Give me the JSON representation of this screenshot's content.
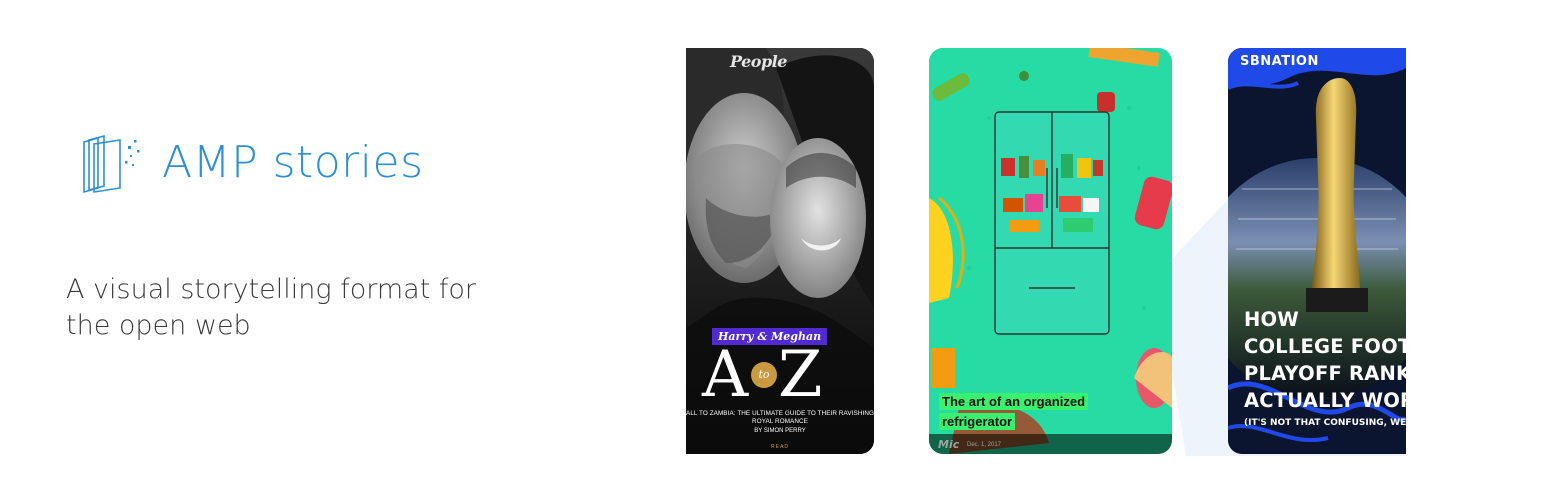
{
  "brand": {
    "logo_icon": "amp-stories-logo-icon",
    "name": "AMP stories",
    "color": "#2d8fd7"
  },
  "tagline": {
    "line1": "A visual storytelling format for",
    "line2": "the open web"
  },
  "stories": [
    {
      "publisher": "People",
      "tag": "Harry & Meghan",
      "title_left": "A",
      "title_mid": "to",
      "title_right": "Z",
      "subtitle_line1": "ALL TO ZAMBIA: THE ULTIMATE GUIDE TO THEIR RAVISHING",
      "subtitle_line2": "ROYAL ROMANCE",
      "author": "BY SIMON PERRY",
      "cta": "READ",
      "accent": "#4f2bd1"
    },
    {
      "caption_line1": "The art of an organized",
      "caption_line2": "refrigerator",
      "publisher": "Mic",
      "date": "Dec. 1, 2017",
      "background": "#26dca4",
      "highlight": "#39f06f"
    },
    {
      "publisher": "SBNATION",
      "title_line1": "HOW",
      "title_line2": "COLLEGE FOOTB",
      "title_line3": "PLAYOFF RANKI",
      "title_line4": "ACTUALLY WOR",
      "subtitle": "(IT'S NOT THAT CONFUSING, WE PROM",
      "accent": "#1f49e8"
    }
  ]
}
